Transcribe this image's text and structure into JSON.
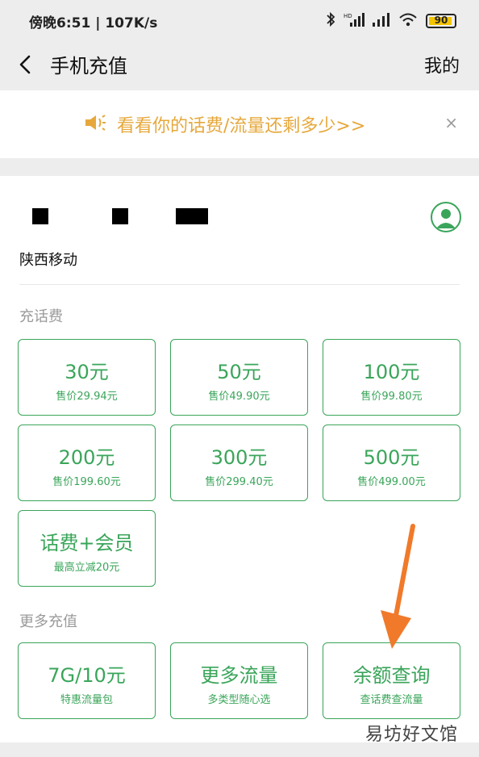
{
  "status_bar": {
    "time_speed": "傍晚6:51 | 107K/s",
    "battery": "90"
  },
  "nav": {
    "title": "手机充值",
    "mine": "我的"
  },
  "banner": {
    "text": "看看你的话费/流量还剩多少>>",
    "close": "×"
  },
  "account": {
    "operator": "陕西移动"
  },
  "sections": {
    "recharge_title": "充话费",
    "more_title": "更多充值"
  },
  "recharge_tiles": [
    {
      "amount": "30元",
      "price": "售价29.94元"
    },
    {
      "amount": "50元",
      "price": "售价49.90元"
    },
    {
      "amount": "100元",
      "price": "售价99.80元"
    },
    {
      "amount": "200元",
      "price": "售价199.60元"
    },
    {
      "amount": "300元",
      "price": "售价299.40元"
    },
    {
      "amount": "500元",
      "price": "售价499.00元"
    },
    {
      "amount": "话费+会员",
      "price": "最高立减20元"
    }
  ],
  "more_tiles": [
    {
      "title": "7G/10元",
      "sub": "特惠流量包"
    },
    {
      "title": "更多流量",
      "sub": "多类型随心选"
    },
    {
      "title": "余额查询",
      "sub": "查话费查流量"
    }
  ],
  "watermark": "易坊好文馆",
  "colors": {
    "accent": "#3aa55a",
    "banner_text": "#e6a83c",
    "arrow": "#f07a2a"
  }
}
